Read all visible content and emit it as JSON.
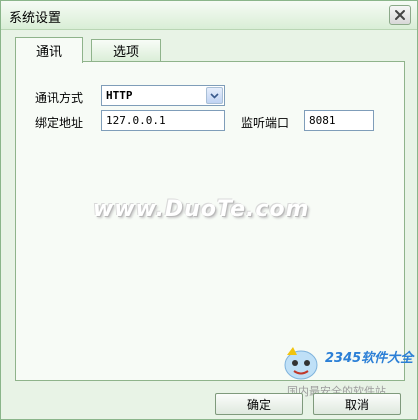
{
  "window": {
    "title": "系统设置"
  },
  "tabs": [
    {
      "label": "通讯",
      "active": true
    },
    {
      "label": "选项",
      "active": false
    }
  ],
  "form": {
    "method_label": "通讯方式",
    "method_value": "HTTP",
    "address_label": "绑定地址",
    "address_value": "127.0.0.1",
    "port_label": "监听端口",
    "port_value": "8081"
  },
  "watermark": {
    "text": "www.DuoTe.com"
  },
  "logo": {
    "brand": "2345软件大全",
    "tagline": "国内最安全的软件站"
  },
  "buttons": {
    "ok": "确定",
    "cancel": "取消"
  },
  "icons": {
    "close": "close-icon",
    "dropdown": "chevron-down-icon"
  },
  "colors": {
    "window_bg": "#e8f3e6",
    "accent_border": "#8fb38b"
  }
}
